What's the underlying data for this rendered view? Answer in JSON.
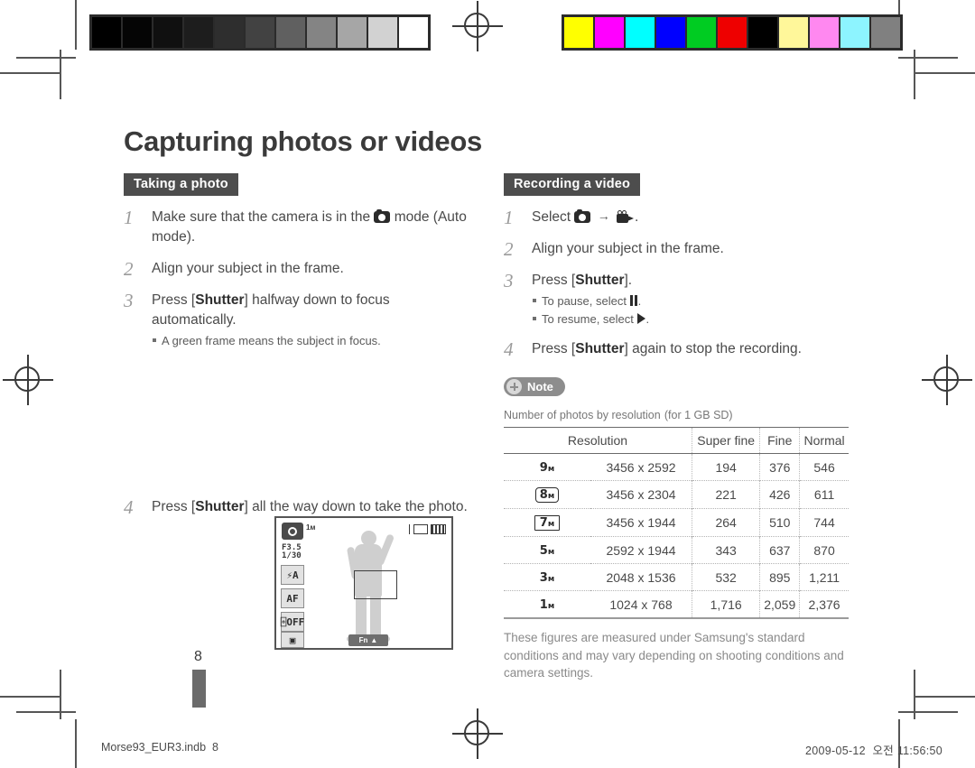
{
  "document": {
    "title": "Capturing photos or videos",
    "page_number": "8"
  },
  "left_column": {
    "section_label": "Taking a photo",
    "steps": [
      {
        "num": "1",
        "text_before": "Make sure that the camera is in the",
        "icon": "camera-icon",
        "text_after": "mode (Auto mode)."
      },
      {
        "num": "2",
        "text": "Align your subject in the frame."
      },
      {
        "num": "3",
        "text_prefix": "Press [",
        "bold": "Shutter",
        "text_suffix": "] halfway down to focus automatically.",
        "bullets": [
          "A green frame means the subject in focus."
        ]
      },
      {
        "num": "4",
        "text_prefix": "Press [",
        "bold": "Shutter",
        "text_suffix": "] all the way down to take the photo."
      }
    ],
    "lcd": {
      "mode_icon": "camera-mode-icon",
      "resolution_badge": "1м",
      "aperture": "F3.5",
      "shutter_speed": "1/30",
      "flash_label": "⚡A",
      "af_label": "AF",
      "timer_label": "⌻OFF",
      "drive_label": "▣",
      "fn_label": "Fn",
      "fn_arrow": "▲",
      "card_icon": "memory-card-icon",
      "battery_icon": "battery-icon"
    }
  },
  "right_column": {
    "section_label": "Recording a video",
    "steps": [
      {
        "num": "1",
        "text_prefix": "Select",
        "icon_a": "camera-icon",
        "arrow": "→",
        "icon_b": "video-camera-icon",
        "text_suffix": "."
      },
      {
        "num": "2",
        "text": "Align your subject in the frame."
      },
      {
        "num": "3",
        "text_prefix": "Press [",
        "bold": "Shutter",
        "text_suffix": "].",
        "bullets": [
          {
            "prefix": "To pause, select",
            "icon": "pause-icon",
            "suffix": "."
          },
          {
            "prefix": "To resume, select",
            "icon": "play-icon",
            "suffix": "."
          }
        ]
      },
      {
        "num": "4",
        "text_prefix": "Press [",
        "bold": "Shutter",
        "text_suffix": "] again to stop the recording."
      }
    ],
    "note": {
      "badge_label": "Note",
      "badge_icon": "plus-circle-icon",
      "table_title": "Number of photos by resolution",
      "table_title_suffix": "(for 1 GB SD)"
    },
    "footnote": "These figures are measured under Samsung's standard conditions and may vary depending on shooting conditions and camera settings."
  },
  "table": {
    "headers": [
      "Resolution",
      "Super fine",
      "Fine",
      "Normal"
    ],
    "rows": [
      {
        "badge": "9",
        "badge_unit": "м",
        "badge_style": "plain",
        "dimensions": "3456 x 2592",
        "super_fine": "194",
        "fine": "376",
        "normal": "546"
      },
      {
        "badge": "8",
        "badge_unit": "м",
        "badge_style": "box",
        "dimensions": "3456 x 2304",
        "super_fine": "221",
        "fine": "426",
        "normal": "611"
      },
      {
        "badge": "7",
        "badge_unit": "м",
        "badge_style": "wide",
        "dimensions": "3456 x 1944",
        "super_fine": "264",
        "fine": "510",
        "normal": "744"
      },
      {
        "badge": "5",
        "badge_unit": "м",
        "badge_style": "plain",
        "dimensions": "2592 x 1944",
        "super_fine": "343",
        "fine": "637",
        "normal": "870"
      },
      {
        "badge": "3",
        "badge_unit": "м",
        "badge_style": "plain",
        "dimensions": "2048 x 1536",
        "super_fine": "532",
        "fine": "895",
        "normal": "1,211"
      },
      {
        "badge": "1",
        "badge_unit": "м",
        "badge_style": "plain",
        "dimensions": "1024 x 768",
        "super_fine": "1,716",
        "fine": "2,059",
        "normal": "2,376"
      }
    ]
  },
  "footer": {
    "file_name": "Morse93_EUR3.indb",
    "file_page": "8",
    "date": "2009-05-12",
    "meridiem": "오전",
    "time": "11:56:50"
  },
  "calibration": {
    "grayscale": [
      "#000000",
      "#050505",
      "#101010",
      "#1d1d1d",
      "#2e2e2e",
      "#424242",
      "#606060",
      "#848484",
      "#a6a6a6",
      "#d2d2d2",
      "#ffffff"
    ],
    "colors": [
      "#ffff00",
      "#ff00ff",
      "#00ffff",
      "#0000ff",
      "#00cc22",
      "#ee0000",
      "#000000",
      "#fff79a",
      "#ff88f0",
      "#8df4ff",
      "#808080"
    ]
  }
}
